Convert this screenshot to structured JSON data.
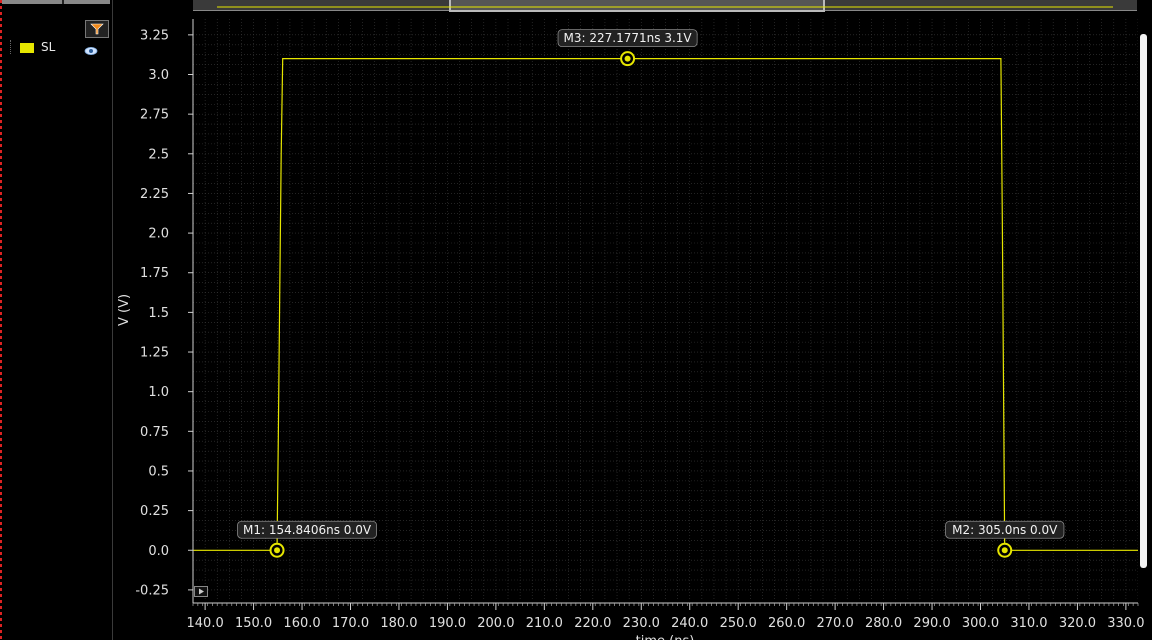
{
  "legend": {
    "items": [
      {
        "label": "SL",
        "color": "#e6e600",
        "icon": "eye-icon"
      }
    ],
    "filter_icon": "filter-icon"
  },
  "colors": {
    "background": "#000000",
    "grid": "#3a3a3a",
    "trace": "#e6e600",
    "text": "#e0e0e0"
  },
  "chart_data": {
    "type": "line",
    "ylabel": "V (V)",
    "xlabel": "time (ns)",
    "xlim": [
      137.5,
      332.5
    ],
    "ylim": [
      -0.32,
      3.35
    ],
    "xticks": [
      "140.0",
      "150.0",
      "160.0",
      "170.0",
      "180.0",
      "190.0",
      "200.0",
      "210.0",
      "220.0",
      "230.0",
      "240.0",
      "250.0",
      "260.0",
      "270.0",
      "280.0",
      "290.0",
      "300.0",
      "310.0",
      "320.0",
      "330.0"
    ],
    "yticks": [
      "3.25",
      "3.0",
      "2.75",
      "2.5",
      "2.25",
      "2.0",
      "1.75",
      "1.5",
      "1.25",
      "1.0",
      "0.75",
      "0.5",
      "0.25",
      "0.0",
      "-0.25"
    ],
    "grid": true,
    "series": [
      {
        "name": "SL",
        "color": "#e6e600",
        "x": [
          137.5,
          154.84,
          155.1,
          155.4,
          155.7,
          156.0,
          304.2,
          304.5,
          304.8,
          305.0,
          332.5
        ],
        "y": [
          0.0,
          0.0,
          0.7,
          1.6,
          2.5,
          3.1,
          3.1,
          2.1,
          0.8,
          0.0,
          0.0
        ]
      }
    ],
    "markers": [
      {
        "label": "M1: 154.8406ns 0.0V",
        "x": 154.8406,
        "y": 0.0
      },
      {
        "label": "M3: 227.1771ns 3.1V",
        "x": 227.1771,
        "y": 3.1
      },
      {
        "label": "M2: 305.0ns 0.0V",
        "x": 305.0,
        "y": 0.0
      }
    ]
  }
}
